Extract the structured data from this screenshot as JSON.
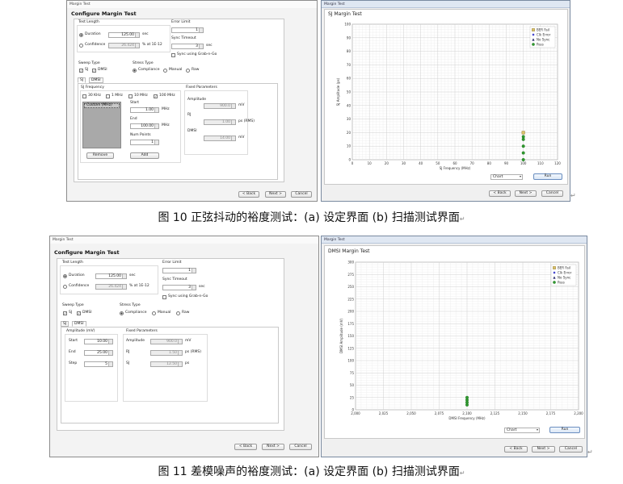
{
  "fig10": {
    "setup": {
      "window_title": "Margin Test",
      "heading": "Configure Margin Test",
      "test_length": {
        "title": "Test Length",
        "duration_label": "Duration",
        "duration_value": "125.00",
        "duration_unit": "sec",
        "confidence_label": "Confidence",
        "confidence_value": "26.424",
        "confidence_unit": "% at 1E-12"
      },
      "error_limit": {
        "title": "Error Limit",
        "value": "1"
      },
      "sync_timeout": {
        "title": "Sync Timeout",
        "value": "3",
        "unit": "sec",
        "grab_label": "Sync using Grab-n-Go"
      },
      "sweep_type": {
        "title": "Sweep Type",
        "sj_label": "SJ",
        "dmsi_label": "DMSI"
      },
      "stress_type": {
        "title": "Stress Type",
        "compliance": "Compliance",
        "manual": "Manual",
        "raw": "Raw"
      },
      "tabs": [
        "SJ",
        "DMSI"
      ],
      "sj_frequency": {
        "title": "SJ Frequency",
        "f30k": "30 KHz",
        "f1m": "1 MHz",
        "f10m": "10 MHz",
        "f100m": "100 MHz"
      },
      "list_item": "Custom (MHz)",
      "start": {
        "label": "Start",
        "value": "1.00",
        "unit": "MHz"
      },
      "end": {
        "label": "End",
        "value": "100.00",
        "unit": "MHz"
      },
      "num_points": {
        "label": "Num Points",
        "value": "1"
      },
      "remove": "Remove",
      "add": "Add",
      "fixed": {
        "title": "Fixed Parameters",
        "amplitude_label": "Amplitude",
        "amplitude_value": "900.0",
        "amplitude_unit": "mV",
        "rj_label": "RJ",
        "rj_value": "1.00",
        "rj_unit": "ps (RMS)",
        "dmsi_label": "DMSI",
        "dmsi_value": "14.00",
        "dmsi_unit": "mV"
      },
      "back": "< Back",
      "next": "Next >",
      "cancel": "Cancel"
    },
    "scan": {
      "window_title": "Margin Test",
      "plot_title": "SJ Margin Test",
      "select": "Chart",
      "run": "Run",
      "back": "< Back",
      "next": "Next >",
      "cancel": "Cancel"
    },
    "caption": "图 10  正弦抖动的裕度测试：(a) 设定界面  (b) 扫描测试界面"
  },
  "fig11": {
    "setup": {
      "window_title": "Margin Test",
      "heading": "Configure Margin Test",
      "test_length": {
        "title": "Test Length",
        "duration_label": "Duration",
        "duration_value": "125.00",
        "duration_unit": "sec",
        "confidence_label": "Confidence",
        "confidence_value": "26.424",
        "confidence_unit": "% at 1E-12"
      },
      "error_limit": {
        "title": "Error Limit",
        "value": "1"
      },
      "sync_timeout": {
        "title": "Sync Timeout",
        "value": "3",
        "unit": "sec",
        "grab_label": "Sync using Grab-n-Go"
      },
      "sweep_type": {
        "title": "Sweep Type",
        "sj_label": "SJ",
        "dmsi_label": "DMSI"
      },
      "stress_type": {
        "title": "Stress Type",
        "compliance": "Compliance",
        "manual": "Manual",
        "raw": "Raw"
      },
      "tabs": [
        "SJ",
        "DMSI"
      ],
      "amplitude": {
        "title": "Amplitude (mV)",
        "start_label": "Start",
        "start_value": "10.00",
        "end_label": "End",
        "end_value": "25.00",
        "step_label": "Step",
        "step_value": "5"
      },
      "fixed": {
        "title": "Fixed Parameters",
        "amplitude_label": "Amplitude",
        "amplitude_value": "900.0",
        "amplitude_unit": "mV",
        "rj_label": "RJ",
        "rj_value": "1.50",
        "rj_unit": "ps (RMS)",
        "sj_label": "SJ",
        "sj_value": "12.50",
        "sj_unit": "ps"
      },
      "back": "< Back",
      "next": "Next >",
      "cancel": "Cancel"
    },
    "scan": {
      "window_title": "Margin Test",
      "plot_title": "DMSI Margin Test",
      "select": "Chart",
      "run": "Run",
      "back": "< Back",
      "next": "Next >",
      "cancel": "Cancel"
    },
    "caption": "图 11 差模噪声的裕度测试：(a) 设定界面  (b) 扫描测试界面"
  },
  "return_mark": "↵",
  "chart_data": [
    {
      "type": "scatter",
      "title": "SJ Margin Test",
      "xlabel": "SJ Frequency (MHz)",
      "ylabel": "SJ Amplitude (ps)",
      "xlim": [
        0,
        120
      ],
      "ylim": [
        0,
        100
      ],
      "x_ticks": [
        0,
        10,
        20,
        30,
        40,
        50,
        60,
        70,
        80,
        90,
        100,
        110,
        120
      ],
      "y_ticks": [
        0,
        10,
        20,
        30,
        40,
        50,
        60,
        70,
        80,
        90,
        100
      ],
      "grid": true,
      "legend": [
        "BER Fail",
        "Clk Error",
        "No Sync",
        "Pass"
      ],
      "legend_position": "top-right",
      "series": [
        {
          "name": "BER Fail",
          "x": [
            100
          ],
          "y": [
            20
          ],
          "color": "#c8a85a"
        },
        {
          "name": "Pass",
          "x": [
            100,
            100,
            100,
            100,
            100
          ],
          "y": [
            0,
            5,
            10,
            15,
            17
          ],
          "color": "#2e9a2e"
        }
      ]
    },
    {
      "type": "scatter",
      "title": "DMSI Margin Test",
      "xlabel": "DMSI Frequency (MHz)",
      "ylabel": "DMSI Amplitude (mV)",
      "xlim": [
        2000,
        2200
      ],
      "ylim": [
        0,
        300
      ],
      "x_ticks": [
        2000,
        2025,
        2050,
        2075,
        2100,
        2125,
        2150,
        2175,
        2200
      ],
      "x_tick_labels": [
        "2,000",
        "2,025",
        "2,050",
        "2,075",
        "2,100",
        "2,125",
        "2,150",
        "2,175",
        "2,200"
      ],
      "y_ticks": [
        0,
        25,
        50,
        75,
        100,
        125,
        150,
        175,
        200,
        225,
        250,
        275,
        300
      ],
      "grid": true,
      "legend": [
        "BER Fail",
        "Clk Error",
        "No Sync",
        "Pass"
      ],
      "legend_position": "top-right",
      "series": [
        {
          "name": "Pass",
          "x": [
            2100,
            2100,
            2100,
            2100
          ],
          "y": [
            10,
            15,
            20,
            25
          ],
          "color": "#2e9a2e"
        }
      ]
    }
  ]
}
